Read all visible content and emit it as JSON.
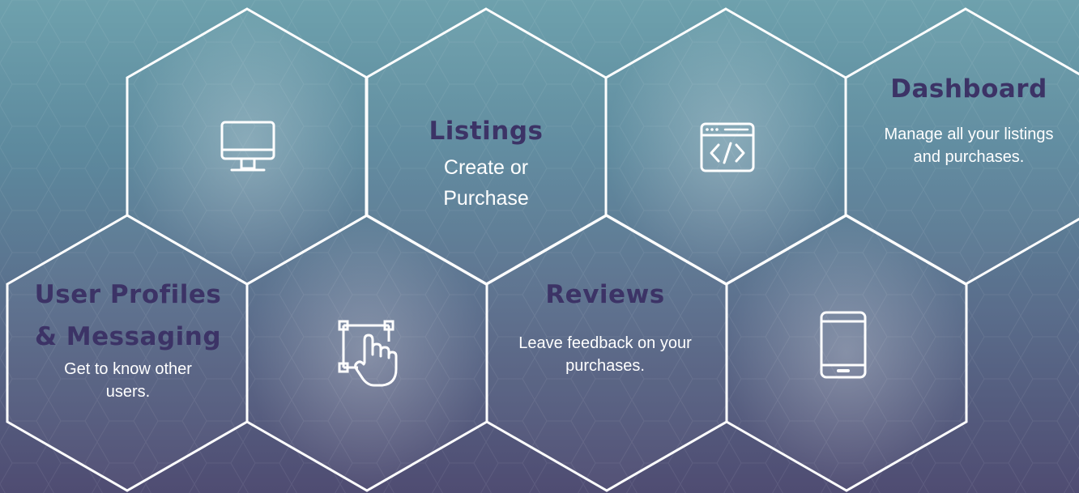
{
  "colors": {
    "title": "#3c3366",
    "stroke": "#ffffff",
    "text": "#ffffff"
  },
  "features": {
    "listings": {
      "title": "Listings",
      "line1": "Create or",
      "line2": "Purchase"
    },
    "dashboard": {
      "title": "Dashboard",
      "line1": "Manage all your listings",
      "line2": "and purchases."
    },
    "profiles": {
      "title_line1": "User Profiles",
      "title_line2": "& Messaging",
      "line1": "Get to know other",
      "line2": "users."
    },
    "reviews": {
      "title": "Reviews",
      "line1": "Leave feedback on your",
      "line2": "purchases."
    }
  },
  "icons": [
    "monitor-icon",
    "code-window-icon",
    "touch-select-icon",
    "tablet-icon"
  ]
}
